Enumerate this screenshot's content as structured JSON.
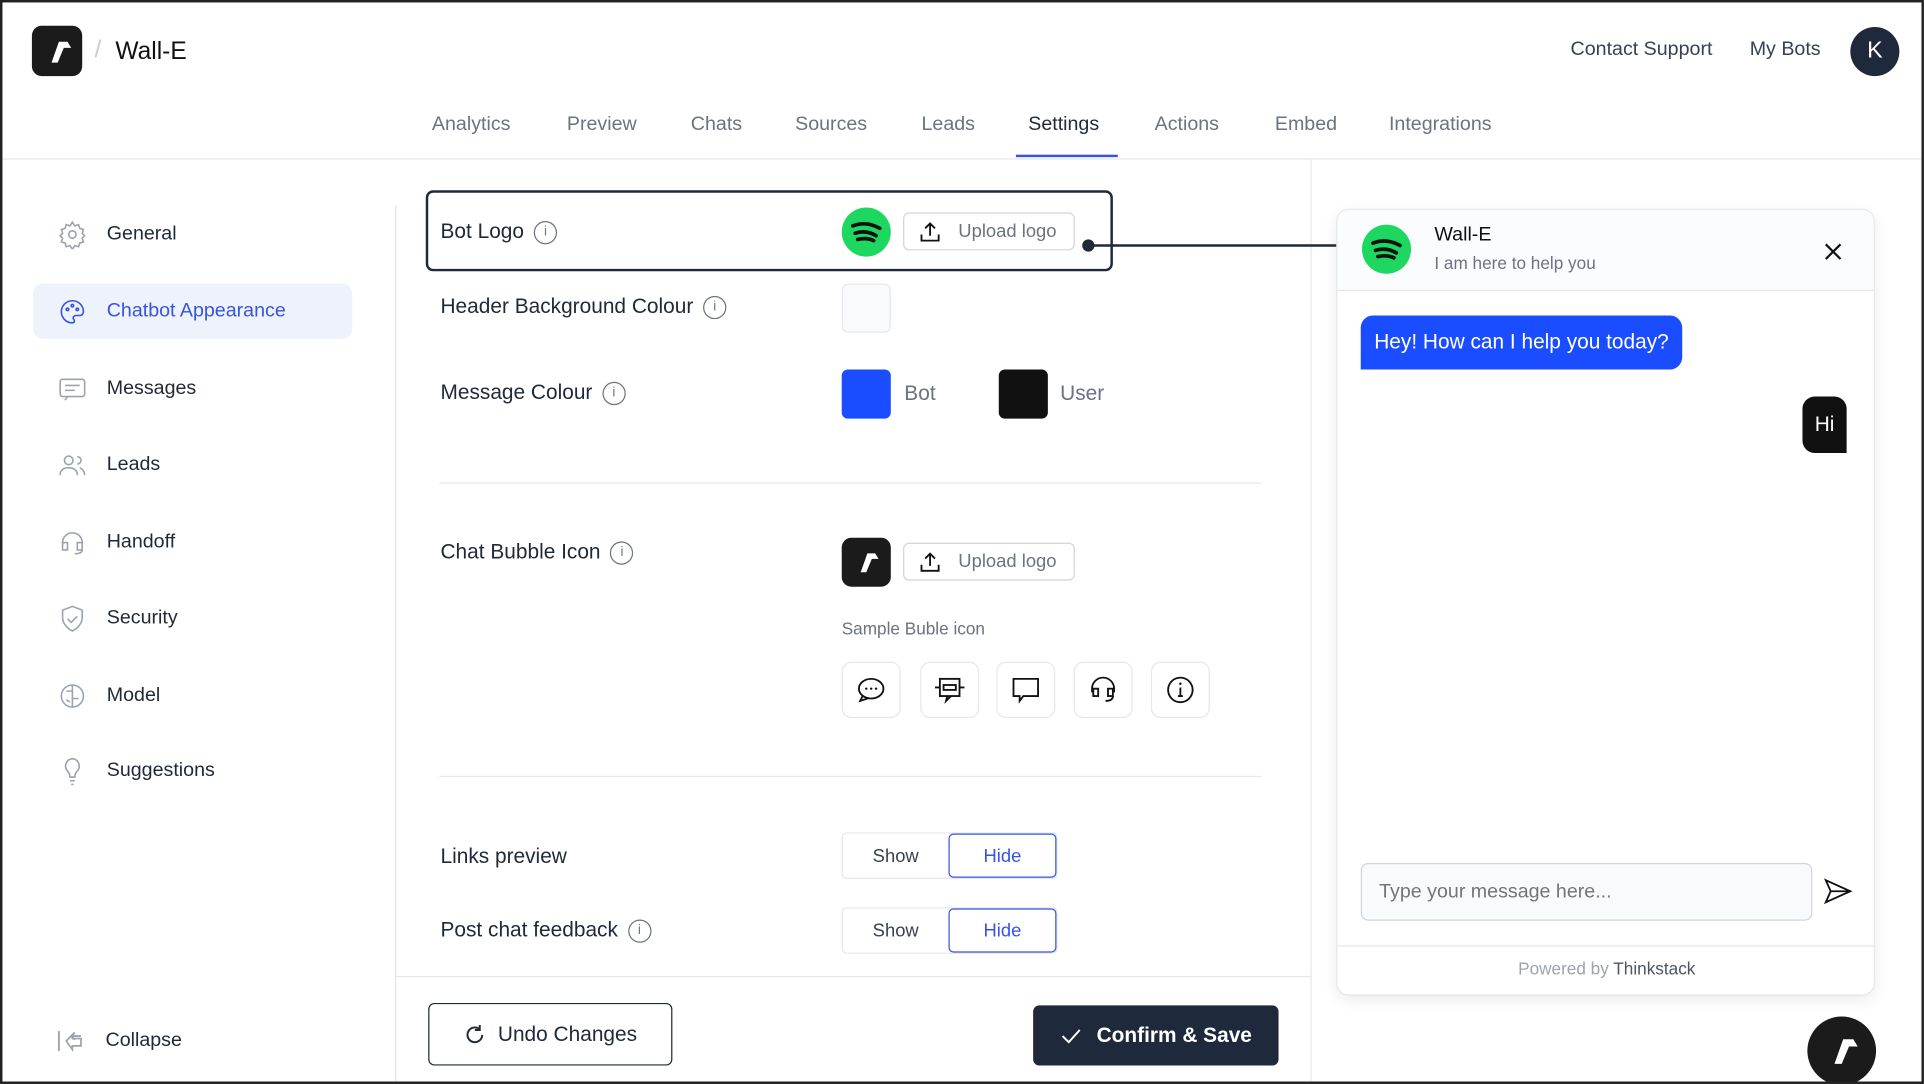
{
  "header": {
    "bot_name": "Wall-E",
    "separator": "/",
    "contact_support": "Contact Support",
    "my_bots": "My Bots",
    "avatar_initial": "K"
  },
  "tabs": [
    {
      "label": "Analytics"
    },
    {
      "label": "Preview"
    },
    {
      "label": "Chats"
    },
    {
      "label": "Sources"
    },
    {
      "label": "Leads"
    },
    {
      "label": "Settings",
      "active": true
    },
    {
      "label": "Actions"
    },
    {
      "label": "Embed"
    },
    {
      "label": "Integrations"
    }
  ],
  "sidebar": {
    "items": [
      {
        "label": "General",
        "icon": "gear-icon"
      },
      {
        "label": "Chatbot Appearance",
        "icon": "palette-icon",
        "active": true
      },
      {
        "label": "Messages",
        "icon": "message-icon"
      },
      {
        "label": "Leads",
        "icon": "users-icon"
      },
      {
        "label": "Handoff",
        "icon": "headset-icon"
      },
      {
        "label": "Security",
        "icon": "shield-icon"
      },
      {
        "label": "Model",
        "icon": "brain-icon"
      },
      {
        "label": "Suggestions",
        "icon": "lightbulb-icon"
      }
    ],
    "collapse": "Collapse"
  },
  "settings": {
    "bot_logo": {
      "label": "Bot Logo",
      "info": "i",
      "upload": "Upload logo"
    },
    "header_bg": {
      "label": "Header Background Colour",
      "info": "i",
      "color": "#f9fafb"
    },
    "message_colour": {
      "label": "Message Colour",
      "info": "i",
      "bot_label": "Bot",
      "bot_color": "#1a4dff",
      "user_label": "User",
      "user_color": "#111111"
    },
    "chat_bubble": {
      "label": "Chat Bubble Icon",
      "info": "i",
      "upload": "Upload logo",
      "sample_label": "Sample Buble icon",
      "samples": [
        "chat-dots-icon",
        "robot-icon",
        "message-square-icon",
        "headset-icon",
        "info-icon"
      ]
    },
    "links_preview": {
      "label": "Links preview",
      "show": "Show",
      "hide": "Hide",
      "selected": "Hide"
    },
    "post_chat_feedback": {
      "label": "Post chat feedback",
      "info": "i",
      "show": "Show",
      "hide": "Hide",
      "selected": "Hide"
    }
  },
  "footer": {
    "undo": "Undo Changes",
    "confirm": "Confirm & Save"
  },
  "preview": {
    "name": "Wall-E",
    "subtitle": "I am here to help you",
    "bot_message": "Hey! How can I help you today?",
    "user_message": "Hi",
    "input_placeholder": "Type your message here...",
    "powered_by": "Powered by",
    "brand": "Thinkstack"
  },
  "colors": {
    "accent": "#3654e0",
    "primary_button": "#1e293b",
    "bot_bubble": "#1a4dff",
    "spotify_green": "#1ed760"
  }
}
